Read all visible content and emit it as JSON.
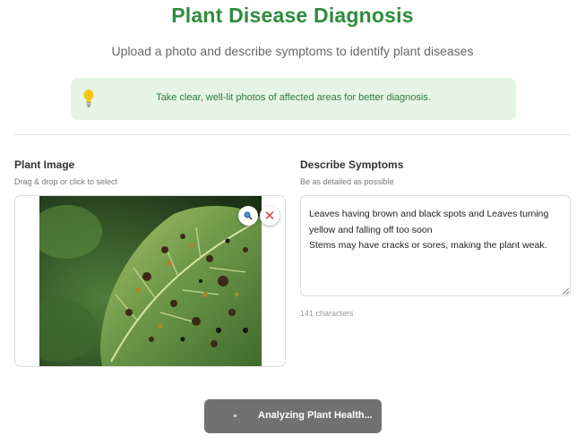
{
  "header": {
    "title": "Plant Disease Diagnosis",
    "subtitle": "Upload a photo and describe symptoms to identify plant diseases"
  },
  "tip": {
    "icon": "lightbulb-icon",
    "text": "Take clear, well-lit photos of affected areas for better diagnosis."
  },
  "image_section": {
    "label": "Plant Image",
    "hint": "Drag & drop or click to select",
    "image_alt": "Leaf with brown and black spots",
    "zoom_icon": "magnifier-icon",
    "remove_icon": "close-icon",
    "remove_glyph": "✕"
  },
  "symptoms_section": {
    "label": "Describe Symptoms",
    "hint": "Be as detailed as possible",
    "value": "Leaves having brown and black spots and Leaves turning yellow and falling off too soon\nStems may have cracks or sores, making the plant weak.",
    "char_count": "141 characters"
  },
  "analyze_button": {
    "label": "Analyzing Plant Health...",
    "state": "loading"
  },
  "colors": {
    "brand_green": "#2e8b3d",
    "tip_background": "#e6f4e6",
    "remove_red": "#e23b3b",
    "button_gray": "#717171"
  }
}
